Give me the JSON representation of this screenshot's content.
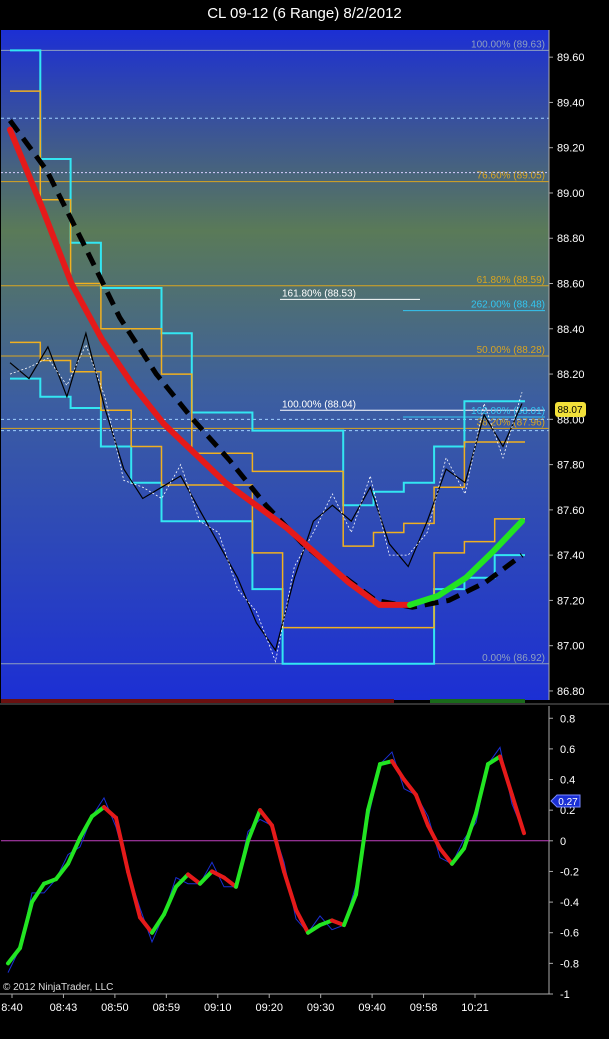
{
  "window": {
    "title": "CL 09-12 (6 Range)  8/2/2012",
    "copyright": "© 2012 NinjaTrader, LLC"
  },
  "colors": {
    "background": "#000000",
    "panel_bg_top": "#1c2fd4",
    "panel_bg_mid": "#5a7a58",
    "fib_line": "#d9a520",
    "cyan_band": "#33e6f2",
    "orange_band": "#f0b020",
    "red_ma": "#e51a1a",
    "green_ma": "#22e522",
    "black_ma": "#000000",
    "price_tag": "#f2e03a",
    "osc_tag": "#1a2fd4"
  },
  "chart_data": [
    {
      "type": "line",
      "name": "price",
      "y_ticks": [
        "89.60",
        "89.40",
        "89.20",
        "89.00",
        "88.80",
        "88.60",
        "88.40",
        "88.20",
        "88.00",
        "87.80",
        "87.60",
        "87.40",
        "87.20",
        "87.00",
        "86.80"
      ],
      "ylim": [
        86.76,
        89.72
      ],
      "x_labels": [
        "8:40",
        "08:43",
        "08:50",
        "08:59",
        "09:10",
        "09:20",
        "09:30",
        "09:40",
        "09:58",
        "10:21"
      ],
      "last_price": "88.07",
      "fib_levels": [
        {
          "label": "100.00% (89.63)",
          "value": 89.63
        },
        {
          "label": "76.60% (89.05)",
          "value": 89.05
        },
        {
          "label": "61.80% (88.59)",
          "value": 88.59
        },
        {
          "label": "50.00% (88.28)",
          "value": 88.28
        },
        {
          "label": "38.20% (87.96)",
          "value": 87.96
        },
        {
          "label": "0.00% (86.92)",
          "value": 86.92
        }
      ],
      "extension_levels": [
        {
          "label": "161.80% (88.53)",
          "value": 88.53
        },
        {
          "label": "262.00% (88.48)",
          "value": 88.48
        },
        {
          "label": "100.00% (88.04)",
          "value": 88.04
        },
        {
          "label": "162.00% (88.01)",
          "value": 88.01
        }
      ],
      "cyan_band_upper": [
        89.63,
        89.15,
        88.78,
        88.58,
        88.58,
        88.38,
        88.03,
        88.03,
        87.95,
        87.95,
        87.95,
        87.62,
        87.68,
        87.72,
        87.88,
        88.08,
        88.08
      ],
      "cyan_band_lower": [
        88.18,
        88.1,
        88.05,
        87.88,
        87.72,
        87.55,
        87.55,
        87.55,
        87.25,
        86.92,
        86.92,
        86.92,
        86.92,
        86.92,
        87.25,
        87.3,
        87.4
      ],
      "price_path": [
        88.25,
        88.18,
        88.32,
        88.1,
        88.38,
        88.05,
        87.78,
        87.65,
        87.7,
        87.75,
        87.6,
        87.45,
        87.3,
        87.1,
        86.98,
        87.3,
        87.55,
        87.62,
        87.55,
        87.7,
        87.45,
        87.35,
        87.55,
        87.78,
        87.72,
        88.02,
        87.88,
        88.07
      ],
      "red_ma": [
        89.28,
        88.95,
        88.6,
        88.35,
        88.15,
        87.98,
        87.85,
        87.72,
        87.62,
        87.52,
        87.4,
        87.28,
        87.18,
        87.18
      ],
      "green_ma": [
        87.18,
        87.22,
        87.3,
        87.42,
        87.55
      ],
      "black_ma": [
        89.32,
        89.1,
        88.78,
        88.45,
        88.2,
        88.0,
        87.82,
        87.62,
        87.45,
        87.32,
        87.2,
        87.17,
        87.2,
        87.28,
        87.4
      ]
    },
    {
      "type": "line",
      "name": "oscillator",
      "y_ticks": [
        "0.8",
        "0.6",
        "0.4",
        "0.2",
        "0",
        "-0.2",
        "-0.4",
        "-0.6",
        "-0.8",
        "-1"
      ],
      "ylim": [
        -1.0,
        0.88
      ],
      "last_value": "0.27",
      "values": [
        -0.8,
        -0.7,
        -0.4,
        -0.28,
        -0.25,
        -0.15,
        0.02,
        0.16,
        0.22,
        0.15,
        -0.2,
        -0.5,
        -0.6,
        -0.48,
        -0.3,
        -0.22,
        -0.28,
        -0.2,
        -0.24,
        -0.3,
        0.0,
        0.2,
        0.1,
        -0.2,
        -0.45,
        -0.6,
        -0.55,
        -0.52,
        -0.55,
        -0.35,
        0.2,
        0.5,
        0.52,
        0.4,
        0.3,
        0.1,
        -0.05,
        -0.15,
        -0.05,
        0.18,
        0.5,
        0.55,
        0.3,
        0.05
      ]
    }
  ]
}
